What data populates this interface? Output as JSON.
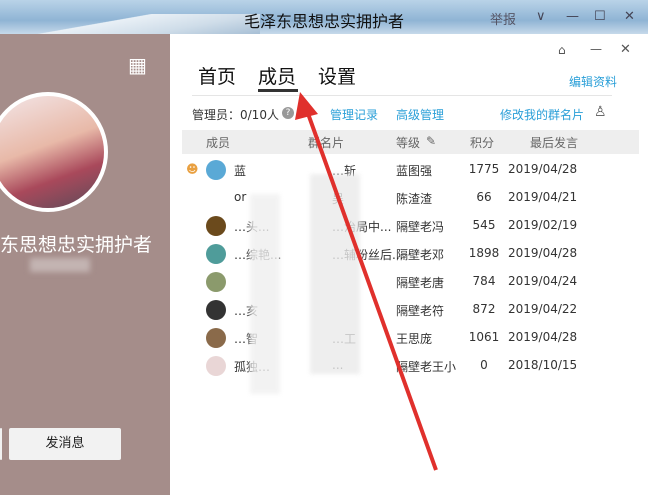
{
  "window": {
    "title": "毛泽东思想忠实拥护者",
    "report": "举报",
    "controls": [
      "chevron-down",
      "minimize",
      "maximize",
      "close"
    ]
  },
  "left": {
    "group_name": "东思想忠实拥护者",
    "send_message": "发消息"
  },
  "panel": {
    "tabs": [
      {
        "label": "首页"
      },
      {
        "label": "成员",
        "active": true
      },
      {
        "label": "设置"
      }
    ],
    "edit_profile": "编辑资料",
    "admins": "管理员：0/10人",
    "admin_log": "管理记录",
    "advanced": "高级管理",
    "edit_card": "修改我的群名片",
    "columns": [
      "成员",
      "群名片",
      "等级",
      "积分",
      "最后发言"
    ],
    "rows": [
      {
        "member": "蓝",
        "card": "…斩",
        "level": "蓝图强",
        "points": "1775",
        "last": "2019/04/28",
        "avatar": "#5aa9d6"
      },
      {
        "member": "or",
        "card": "吴",
        "level": "陈渣渣",
        "points": "66",
        "last": "2019/04/21",
        "avatar": ""
      },
      {
        "member": "…头...",
        "card": "…治局中...",
        "level": "隔壁老冯",
        "points": "545",
        "last": "2019/02/19",
        "avatar": "#6b4a1c"
      },
      {
        "member": "…综艳...",
        "card": "…辅粉丝后...",
        "level": "隔壁老邓",
        "points": "1898",
        "last": "2019/04/28",
        "avatar": "#4f9c9a"
      },
      {
        "member": "",
        "card": "",
        "level": "隔壁老唐",
        "points": "784",
        "last": "2019/04/24",
        "avatar": "#8b9a6c"
      },
      {
        "member": "…亥",
        "card": "",
        "level": "隔壁老符",
        "points": "872",
        "last": "2019/04/22",
        "avatar": "#333"
      },
      {
        "member": "…智",
        "card": "…工",
        "level": "王思庞",
        "points": "1061",
        "last": "2019/04/28",
        "avatar": "#8a6a4a"
      },
      {
        "member": "孤独…",
        "card": "...",
        "level": "隔壁老王小",
        "points": "0",
        "last": "2018/10/15",
        "avatar": "#e9d6d6"
      }
    ]
  },
  "colors": {
    "accent": "#2a9fd8",
    "sidebar": "#a58d8a",
    "arrow": "#e0302c"
  }
}
